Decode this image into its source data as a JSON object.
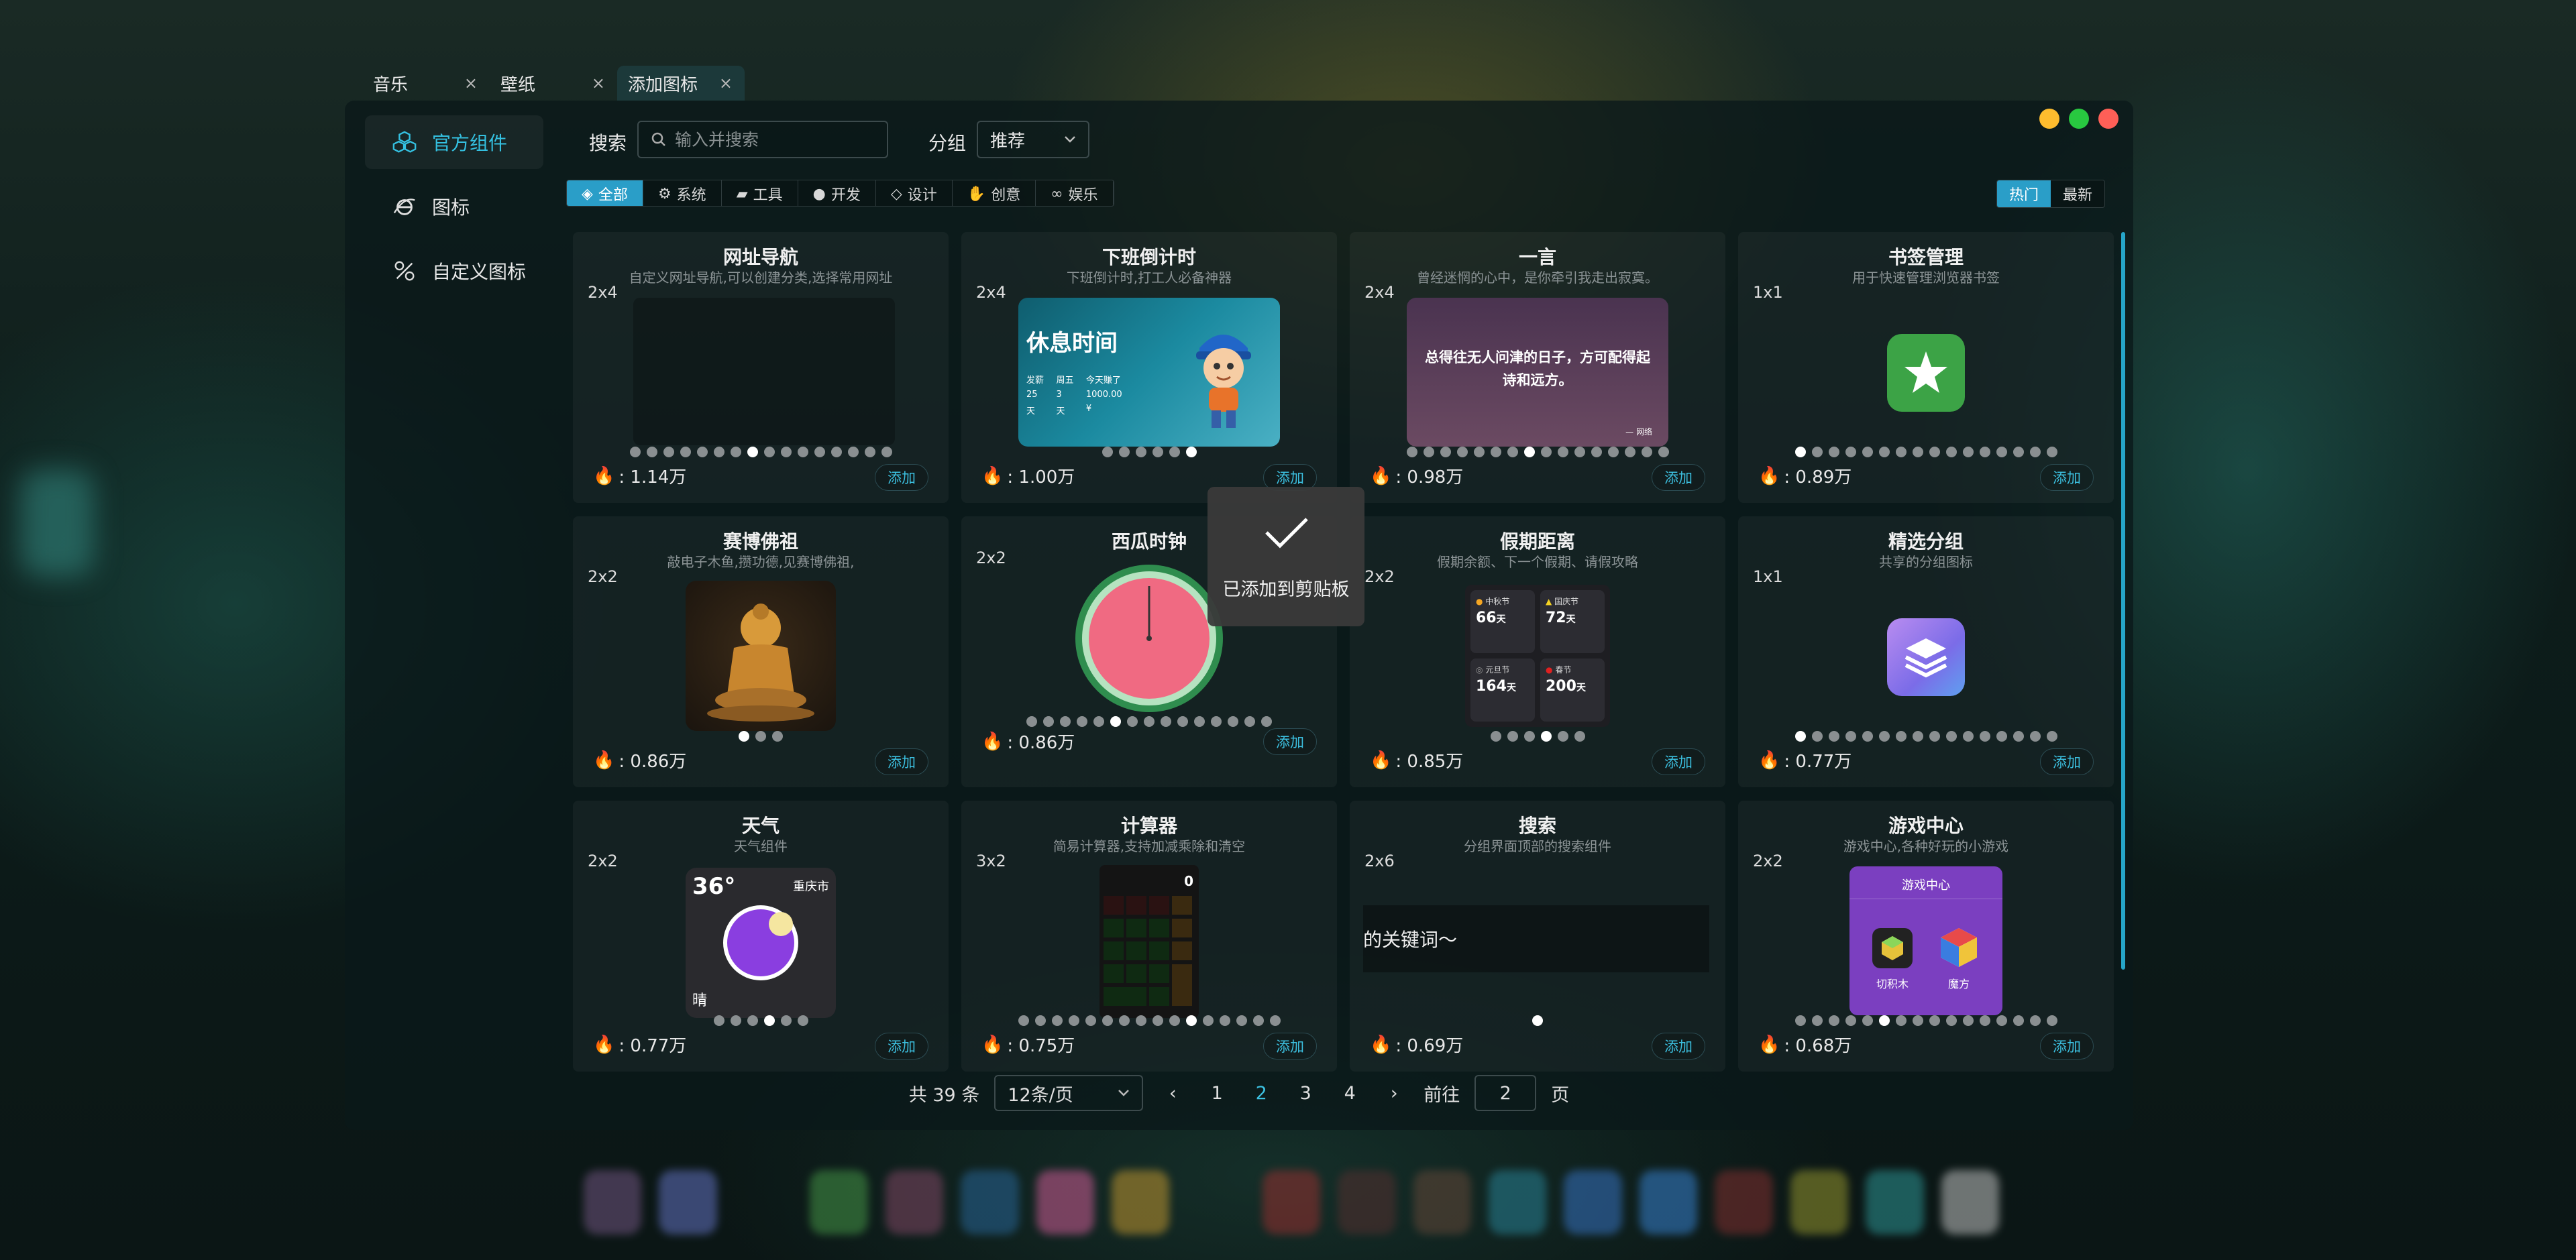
{
  "tabs": [
    {
      "label": "音乐"
    },
    {
      "label": "壁纸"
    },
    {
      "label": "添加图标"
    }
  ],
  "tab_close": "×",
  "sidebar": {
    "items": [
      {
        "label": "官方组件",
        "icon": "cubes-icon"
      },
      {
        "label": "图标",
        "icon": "ie-icon"
      },
      {
        "label": "自定义图标",
        "icon": "custom-icon"
      }
    ]
  },
  "search": {
    "label": "搜索",
    "placeholder": "输入并搜索"
  },
  "group": {
    "label": "分组",
    "value": "推荐"
  },
  "categories": [
    {
      "label": "全部"
    },
    {
      "label": "系统"
    },
    {
      "label": "工具"
    },
    {
      "label": "开发"
    },
    {
      "label": "设计"
    },
    {
      "label": "创意"
    },
    {
      "label": "娱乐"
    }
  ],
  "sort": [
    {
      "label": "热门"
    },
    {
      "label": "最新"
    }
  ],
  "add_label": "添加",
  "cards": [
    {
      "title": "网址导航",
      "desc": "自定义网址导航,可以创建分类,选择常用网址",
      "size": "2x4",
      "hot": ": 1.14万"
    },
    {
      "title": "下班倒计时",
      "desc": "下班倒计时,打工人必备神器",
      "size": "2x4",
      "hot": ": 1.00万"
    },
    {
      "title": "一言",
      "desc": "曾经迷惘的心中，是你牵引我走出寂寞。",
      "size": "2x4",
      "hot": ": 0.98万"
    },
    {
      "title": "书签管理",
      "desc": "用于快速管理浏览器书签",
      "size": "1x1",
      "hot": ": 0.89万"
    },
    {
      "title": "赛博佛祖",
      "desc": "敲电子木鱼,攒功德,见赛博佛祖,",
      "size": "2x2",
      "hot": ": 0.86万"
    },
    {
      "title": "西瓜时钟",
      "desc": "",
      "size": "2x2",
      "hot": ": 0.86万"
    },
    {
      "title": "假期距离",
      "desc": "假期余额、下一个假期、请假攻略",
      "size": "2x2",
      "hot": ": 0.85万"
    },
    {
      "title": "精选分组",
      "desc": "共享的分组图标",
      "size": "1x1",
      "hot": ": 0.77万"
    },
    {
      "title": "天气",
      "desc": "天气组件",
      "size": "2x2",
      "hot": ": 0.77万"
    },
    {
      "title": "计算器",
      "desc": "简易计算器,支持加减乘除和清空",
      "size": "3x2",
      "hot": ": 0.75万"
    },
    {
      "title": "搜索",
      "desc": "分组界面顶部的搜索组件",
      "size": "2x6",
      "hot": ": 0.69万"
    },
    {
      "title": "游戏中心",
      "desc": "游戏中心,各种好玩的小游戏",
      "size": "2x2",
      "hot": ": 0.68万"
    }
  ],
  "previews": {
    "countdown": {
      "title": "休息时间",
      "h1": "发薪",
      "h2": "周五",
      "h3": "今天赚了",
      "v1": "25",
      "v2": "3",
      "v3": "1000.00",
      "u1": "天",
      "u2": "天",
      "u3": "¥"
    },
    "yiyan": {
      "text": "总得往无人问津的日子，方可配得起诗和远方。",
      "author": "— 网络"
    },
    "holiday": [
      {
        "name": "中秋节",
        "value": "66",
        "unit": "天",
        "color": "#f5a623"
      },
      {
        "name": "国庆节",
        "value": "72",
        "unit": "天",
        "color": "#f5d323"
      },
      {
        "name": "元旦节",
        "value": "164",
        "unit": "天",
        "color": "#9b9b9b"
      },
      {
        "name": "春节",
        "value": "200",
        "unit": "天",
        "color": "#e02020"
      }
    ],
    "weather": {
      "temp": "36°",
      "city": "重庆市",
      "cond": "晴"
    },
    "calc": {
      "display": "0"
    },
    "search_text": "的关键词～",
    "game": {
      "title": "游戏中心",
      "g1": "切积木",
      "g2": "魔方"
    }
  },
  "pagination": {
    "total": "共 39 条",
    "page_size": "12条/页",
    "pages": [
      "1",
      "2",
      "3",
      "4"
    ],
    "current": "2",
    "goto_label": "前往",
    "goto_value": "2",
    "page_suffix": "页",
    "prev": "‹",
    "next": "›"
  },
  "toast": {
    "message": "已添加到剪贴板"
  },
  "colors": {
    "accent": "#2a9ec8",
    "link": "#3cc0e0",
    "close": "#ff5f57",
    "minimize": "#febc2e",
    "maximize": "#28c840"
  }
}
